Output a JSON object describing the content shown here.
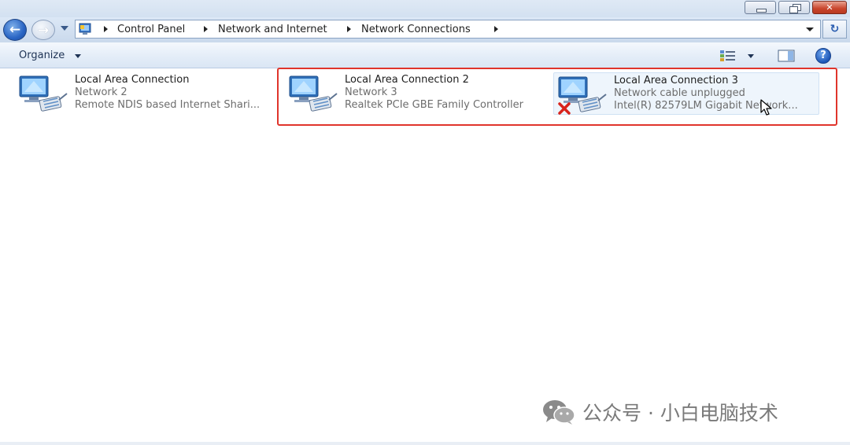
{
  "window": {
    "minimize_glyph": "",
    "close_glyph": "✕"
  },
  "navigation": {
    "back_arrow": "←",
    "forward_arrow": "→",
    "breadcrumb": [
      "Control Panel",
      "Network and Internet",
      "Network Connections"
    ],
    "refresh_glyph": "↻"
  },
  "toolbar": {
    "organize_label": "Organize",
    "help_glyph": "?"
  },
  "connections": [
    {
      "name": "Local Area Connection",
      "network": "Network  2",
      "device": "Remote NDIS based Internet Shari...",
      "status": "connected"
    },
    {
      "name": "Local Area Connection 2",
      "network": "Network  3",
      "device": "Realtek PCIe GBE Family Controller",
      "status": "connected"
    },
    {
      "name": "Local Area Connection 3",
      "network": "Network cable unplugged",
      "device": "Intel(R) 82579LM Gigabit Network...",
      "status": "unplugged",
      "selected": true
    }
  ],
  "watermark": {
    "text": "公众号 · 小白电脑技术"
  },
  "colors": {
    "highlight_border": "#e0352c",
    "unplugged_x": "#d8231c",
    "address_text": "#1e1e1e",
    "secondary_text": "#6d6d6d"
  },
  "icons": {
    "back": "back-arrow-icon",
    "forward": "forward-arrow-icon",
    "control_panel": "control-panel-icon",
    "views": "change-view-icon",
    "preview_pane": "preview-pane-icon",
    "help": "help-icon",
    "connection": "network-adapter-icon",
    "unplugged": "red-x-icon"
  }
}
